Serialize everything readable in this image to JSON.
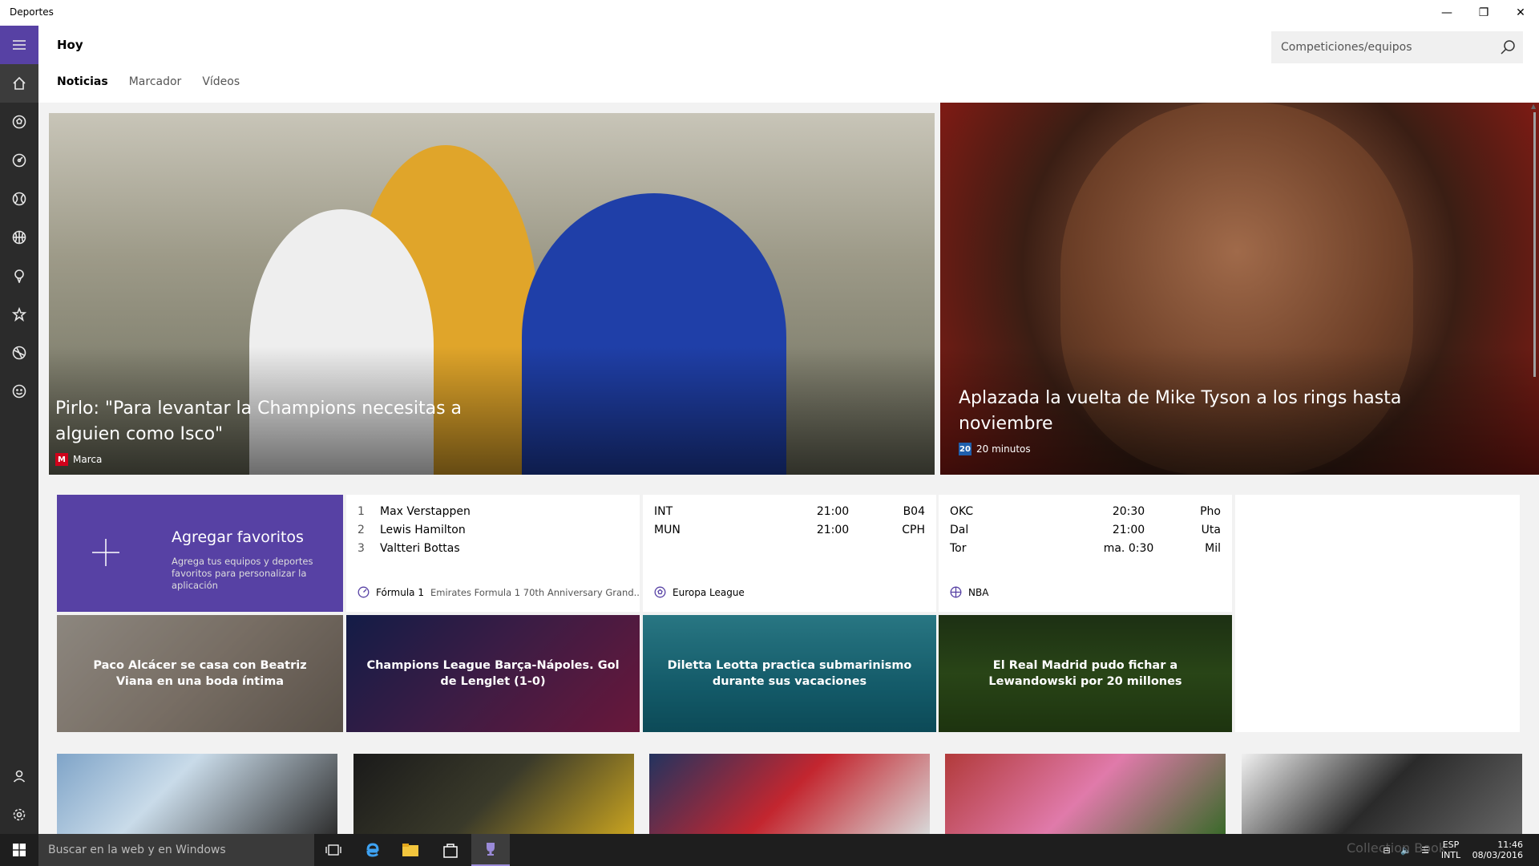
{
  "window": {
    "title": "Deportes",
    "minimize": "—",
    "maximize": "❐",
    "close": "✕"
  },
  "header": {
    "title": "Hoy",
    "search_placeholder": "Competiciones/equipos",
    "tabs": [
      {
        "label": "Noticias",
        "active": true
      },
      {
        "label": "Marcador",
        "active": false
      },
      {
        "label": "Vídeos",
        "active": false
      }
    ]
  },
  "rail": {
    "items": [
      "menu-icon",
      "home-icon",
      "soccer-icon",
      "f1-icon",
      "baseball-icon",
      "basketball-icon",
      "golf-icon",
      "favorites-icon",
      "other-sports-icon",
      "more-icon"
    ],
    "bottom": [
      "profile-icon",
      "settings-icon"
    ],
    "accent": "#5741a4"
  },
  "heroes": [
    {
      "title": "Pirlo: \"Para levantar la Champions necesitas a alguien como Isco\"",
      "source": "Marca",
      "source_logo": "M"
    },
    {
      "title": "Aplazada la vuelta de Mike Tyson a los rings hasta noviembre",
      "source": "20 minutos",
      "source_logo": "20"
    }
  ],
  "favorites_tile": {
    "title": "Agregar favoritos",
    "subtitle": "Agrega tus equipos y deportes favoritos para personalizar la aplicación"
  },
  "f1_tile": {
    "rows": [
      {
        "pos": "1",
        "name": "Max Verstappen"
      },
      {
        "pos": "2",
        "name": "Lewis Hamilton"
      },
      {
        "pos": "3",
        "name": "Valtteri Bottas"
      }
    ],
    "league": "Fórmula 1",
    "event": "Emirates Formula 1 70th Anniversary Grand..."
  },
  "europa_tile": {
    "rows": [
      {
        "home": "INT",
        "time": "21:00",
        "away": "B04"
      },
      {
        "home": "MUN",
        "time": "21:00",
        "away": "CPH"
      }
    ],
    "league": "Europa League"
  },
  "nba_tile": {
    "rows": [
      {
        "home": "OKC",
        "time": "20:30",
        "away": "Pho"
      },
      {
        "home": "Dal",
        "time": "21:00",
        "away": "Uta"
      },
      {
        "home": "Tor",
        "time": "ma. 0:30",
        "away": "Mil"
      }
    ],
    "league": "NBA"
  },
  "news_tiles": [
    {
      "title": "Paco Alcácer se casa con Beatriz Viana en una boda íntima"
    },
    {
      "title": "Champions League Barça-Nápoles. Gol de Lenglet (1-0)"
    },
    {
      "title": "Diletta Leotta practica submarinismo durante sus vacaciones"
    },
    {
      "title": "El Real Madrid pudo fichar a Lewandowski por 20 millones"
    }
  ],
  "taskbar": {
    "search_placeholder": "Buscar en la web y en Windows",
    "lang_top": "ESP",
    "lang_bottom": "INTL",
    "time": "11:46",
    "date": "08/03/2016",
    "watermark": "Collection Book"
  }
}
